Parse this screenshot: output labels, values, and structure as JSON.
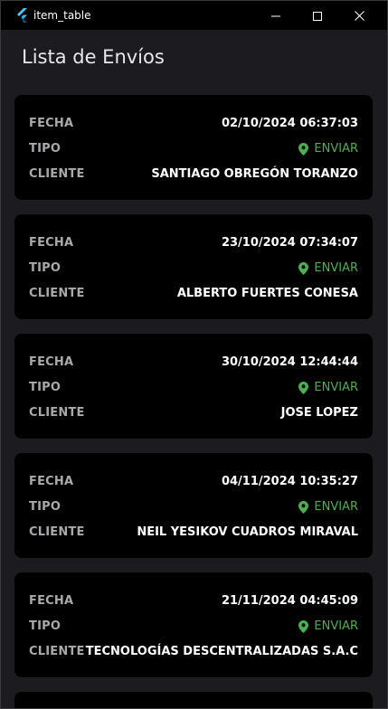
{
  "window": {
    "title": "item_table"
  },
  "page": {
    "title": "Lista de Envíos"
  },
  "labels": {
    "fecha": "FECHA",
    "tipo": "TIPO",
    "cliente": "CLIENTE"
  },
  "colors": {
    "accent_green": "#4caf50",
    "card_bg": "#000000",
    "window_bg": "#1c1b20"
  },
  "icons": {
    "app": "flutter-logo-icon",
    "tipo": "location-pin-icon",
    "minimize": "minimize-icon",
    "maximize": "maximize-icon",
    "close": "close-icon"
  },
  "shipments": [
    {
      "fecha": "02/10/2024 06:37:03",
      "tipo": "ENVIAR",
      "cliente": "SANTIAGO OBREGÓN TORANZO"
    },
    {
      "fecha": "23/10/2024 07:34:07",
      "tipo": "ENVIAR",
      "cliente": "ALBERTO FUERTES CONESA"
    },
    {
      "fecha": "30/10/2024 12:44:44",
      "tipo": "ENVIAR",
      "cliente": "JOSE LOPEZ"
    },
    {
      "fecha": "04/11/2024 10:35:27",
      "tipo": "ENVIAR",
      "cliente": "NEIL YESIKOV CUADROS MIRAVAL"
    },
    {
      "fecha": "21/11/2024 04:45:09",
      "tipo": "ENVIAR",
      "cliente": "TECNOLOGÍAS DESCENTRALIZADAS S.A.C"
    }
  ]
}
